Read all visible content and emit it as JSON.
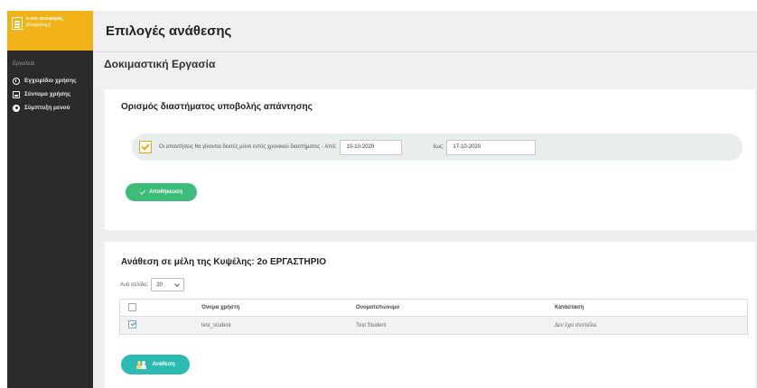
{
  "sidebar": {
    "brand_line1": "e-me αναφοράς",
    "brand_line2": "(Κυψέλης)",
    "section_label": "Εργαλεία",
    "items": [
      {
        "label": "Εγχειρίδιο χρήσης",
        "icon": "question-circle-icon"
      },
      {
        "label": "Σύντομο χρήσης",
        "icon": "book-icon"
      },
      {
        "label": "Σύμπτυξη μενού",
        "icon": "collapse-menu-icon"
      }
    ]
  },
  "header": {
    "title": "Επιλογές ανάθεσης",
    "subtitle": "Δοκιμαστική Εργασία"
  },
  "period": {
    "heading": "Ορισμός διαστήματος υποβολής απάντησης",
    "checkbox_text": "Οι απαντήσεις θα γίνονται δεκτές μόνο εντός χρονικού διαστήματος - Από:",
    "from_value": "10-10-2020",
    "to_label": "έως:",
    "to_value": "17-10-2020",
    "save_label": "Αποθήκευση"
  },
  "assign": {
    "heading": "Ανάθεση σε μέλη της Κυψέλης: 2ο ΕΡΓΑΣΤΗΡΙΟ",
    "per_page_label": "Ανά σελίδα:",
    "per_page_value": "20",
    "columns": [
      "Όνομα χρήστη",
      "Ονοματεπώνυμο",
      "Κατάσταση"
    ],
    "rows": [
      {
        "username": "test_student",
        "fullname": "Test Student",
        "status": "Δεν έχει σνστείλει"
      }
    ],
    "button_label": "Ανάθεση"
  },
  "colors": {
    "sidebar_bg": "#2b2b2b",
    "brand": "#f2b318",
    "save_button": "#3dbc7a",
    "assign_button": "#2bbbb3"
  }
}
